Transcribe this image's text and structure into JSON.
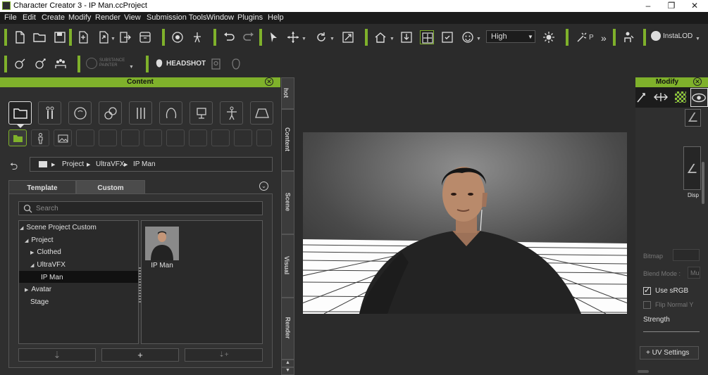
{
  "window": {
    "title": "Character Creator 3 - IP Man.ccProject",
    "minimize": "–",
    "restore": "❐",
    "close": "✕"
  },
  "menu": [
    "File",
    "Edit",
    "Create",
    "Modify",
    "Render",
    "View",
    "Submission Tools",
    "Window",
    "Plugins",
    "Help"
  ],
  "toolbar": {
    "quality": "High",
    "pick_label": "P",
    "overflow": "»",
    "instalod": "InstaLOD",
    "substance_line1": "SUBSTANCE",
    "substance_line2": "PAINTER",
    "headshot": "HEADSHOT"
  },
  "content_panel": {
    "title": "Content",
    "vertical_tabs": [
      "hot",
      "Content",
      "Scene",
      "Visual",
      "Render"
    ],
    "breadcrumb": [
      "Project",
      "UltraVFX",
      "IP Man"
    ],
    "tabs": [
      "Template",
      "Custom"
    ],
    "search_placeholder": "Search",
    "tree": [
      {
        "label": "Scene Project Custom",
        "caret": "◢"
      },
      {
        "label": "Project",
        "caret": "◢"
      },
      {
        "label": "Clothed",
        "caret": "▶"
      },
      {
        "label": "UltraVFX",
        "caret": "◢"
      },
      {
        "label": "IP Man",
        "caret": ""
      },
      {
        "label": "Avatar",
        "caret": "▶"
      },
      {
        "label": "Stage",
        "caret": ""
      }
    ],
    "item_label": "IP Man"
  },
  "modify_panel": {
    "title": "Modify",
    "disp_label": "Disp",
    "bitmap_label": "Bitmap",
    "blend_label": "Blend Mode :",
    "blend_value": "Mu",
    "use_srgb": "Use sRGB",
    "flip_normal": "Flip Normal Y",
    "strength": "Strength",
    "uv_settings": "+ UV Settings"
  }
}
